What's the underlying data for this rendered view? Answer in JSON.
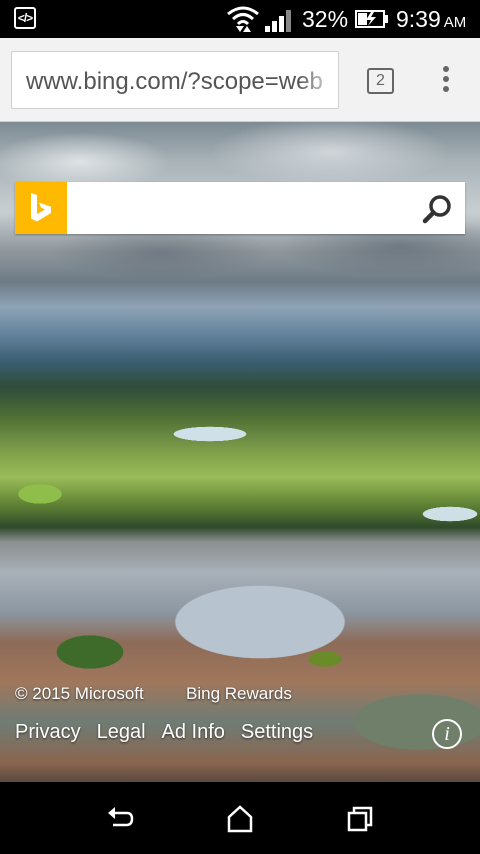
{
  "status_bar": {
    "battery_percent": "32%",
    "time": "9:39",
    "ampm": "AM",
    "icons": [
      "developer-icon",
      "wifi-icon",
      "signal-icon",
      "battery-charging-icon"
    ]
  },
  "browser": {
    "url": "www.bing.com/?scope=web",
    "tab_count": "2"
  },
  "search": {
    "placeholder": "",
    "value": ""
  },
  "footer": {
    "copyright": "© 2015 Microsoft",
    "rewards": "Bing Rewards",
    "links": [
      "Privacy",
      "Legal",
      "Ad Info",
      "Settings"
    ]
  },
  "colors": {
    "bing_yellow": "#ffb900",
    "status_bar": "#000000",
    "toolbar": "#f2f2f2"
  }
}
